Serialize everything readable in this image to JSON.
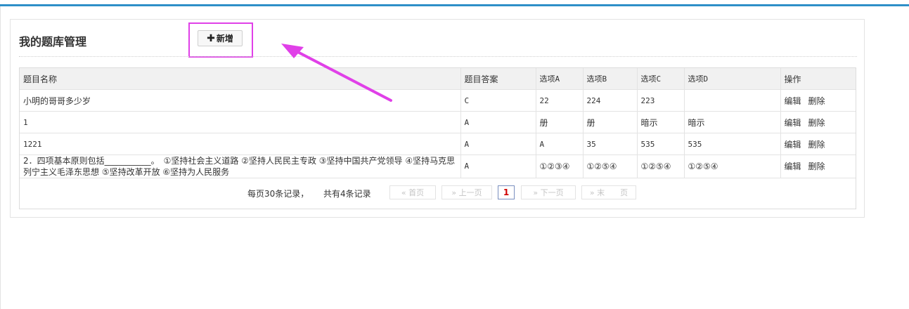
{
  "panel": {
    "title": "我的题库管理",
    "add_button": {
      "icon": "plus-icon",
      "symbol": "✚",
      "label": "新增"
    }
  },
  "table": {
    "headers": [
      "题目名称",
      "题目答案",
      "选项A",
      "选项B",
      "选项C",
      "选项D",
      "操作"
    ],
    "rows": [
      {
        "name": "小明的哥哥多少岁",
        "answer": "C",
        "a": "22",
        "b": "224",
        "c": "223",
        "d": ""
      },
      {
        "name": "1",
        "answer": "A",
        "a": "册",
        "b": "册",
        "c": "暗示",
        "d": "暗示"
      },
      {
        "name": "1221",
        "answer": "A",
        "a": "A",
        "b": "35",
        "c": "535",
        "d": "535"
      },
      {
        "name": "2．四项基本原则包括___________。　①坚持社会主义道路 ②坚持人民民主专政 ③坚持中国共产党领导 ④坚持马克思列宁主义毛泽东思想 ⑤坚持改革开放 ⑥坚持为人民服务",
        "answer": "A",
        "a": "①②③④",
        "b": "①②⑤④",
        "c": "①②⑤④",
        "d": "①②⑤④"
      }
    ],
    "actions": {
      "edit": "编辑",
      "delete": "删除"
    }
  },
  "pager": {
    "per_page": "每页30条记录，",
    "total": "共有4条记录",
    "first": "« 首页",
    "prev": "» 上一页",
    "current": "1",
    "next": "» 下一页",
    "last": "» 末　　页"
  },
  "colors": {
    "accent_bar": "#2e8fc8",
    "highlight": "#e040e8",
    "current_page": "#d00000"
  }
}
